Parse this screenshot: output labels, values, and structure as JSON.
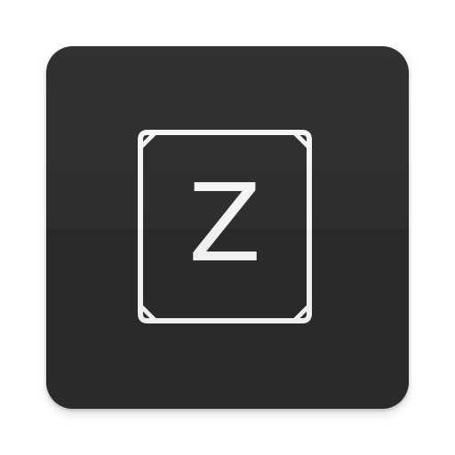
{
  "app_icon": {
    "icon": "z-keycap-icon",
    "letter": "Z",
    "colors": {
      "tile": "#2b2b2b",
      "stroke": "#f4f4f4",
      "letter": "#f4f4f4",
      "background": "#ffffff"
    }
  }
}
